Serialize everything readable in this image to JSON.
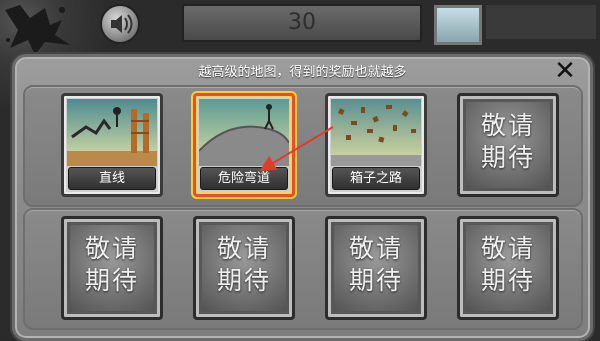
{
  "top_bar": {
    "score": "30"
  },
  "panel": {
    "title": "越高级的地图，得到的奖励也就越多",
    "close_glyph": "✕"
  },
  "levels": [
    {
      "label": "直线",
      "state": "unlocked"
    },
    {
      "label": "危险弯道",
      "state": "selected"
    },
    {
      "label": "箱子之路",
      "state": "unlocked"
    },
    {
      "label": "敬请期待",
      "state": "locked"
    }
  ],
  "locked_row": [
    {
      "label": "敬请期待"
    },
    {
      "label": "敬请期待"
    },
    {
      "label": "敬请期待"
    },
    {
      "label": "敬请期待"
    }
  ],
  "colors": {
    "selection_border": "#e0532a",
    "annotation_arrow": "#e03c2a"
  },
  "icons": {
    "sound": "speaker-icon",
    "close": "close-icon"
  }
}
